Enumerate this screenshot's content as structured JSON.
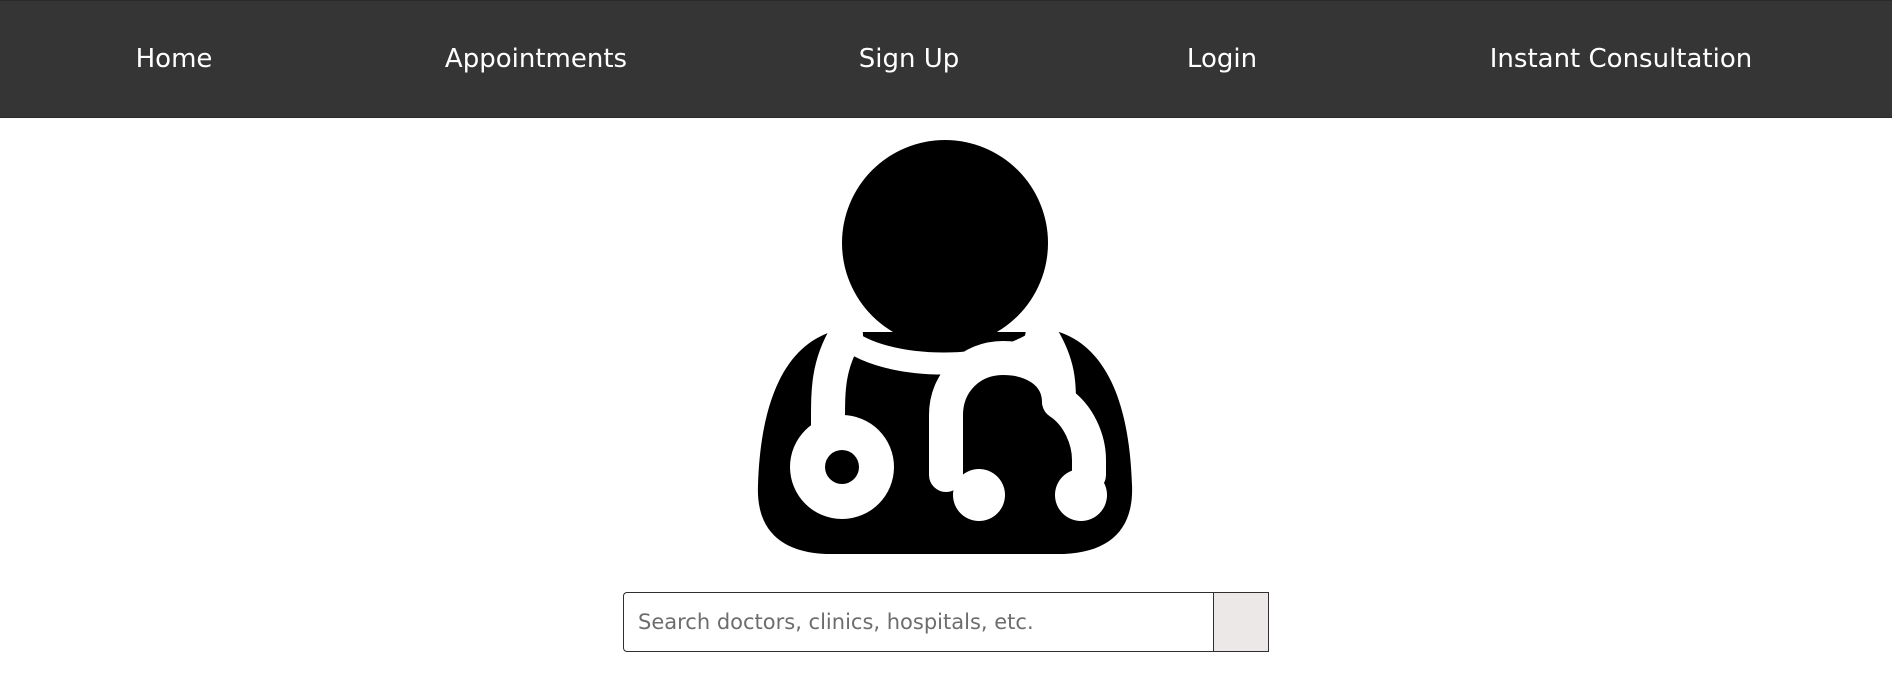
{
  "nav": {
    "home": "Home",
    "appointments": "Appointments",
    "signup": "Sign Up",
    "login": "Login",
    "instant_consultation": "Instant Consultation"
  },
  "hero": {
    "icon": "doctor-icon"
  },
  "search": {
    "placeholder": "Search doctors, clinics, hospitals, etc.",
    "value": "",
    "button_label": ""
  },
  "colors": {
    "navbar_bg": "#353535",
    "nav_text": "#ffffff",
    "icon": "#000000",
    "search_button_bg": "#ede8e8"
  }
}
